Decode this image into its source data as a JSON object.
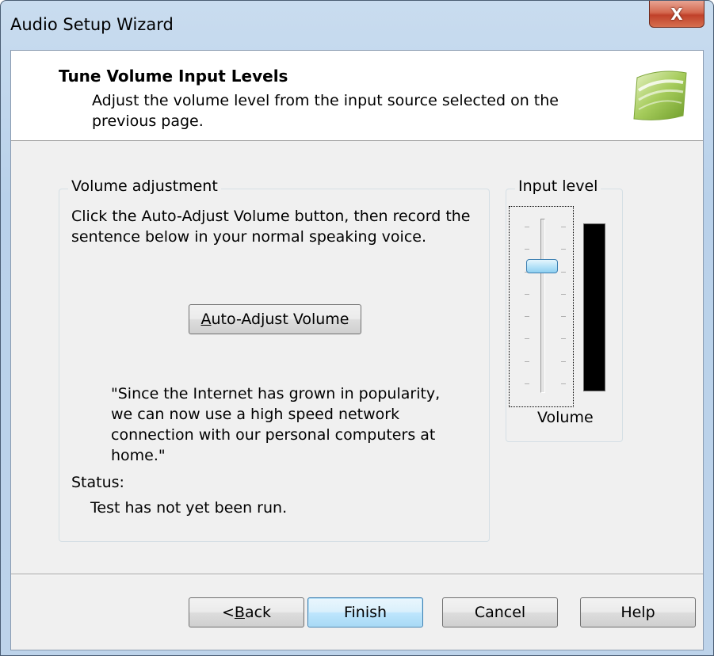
{
  "window": {
    "title": "Audio Setup Wizard",
    "close_glyph": "X"
  },
  "header": {
    "title": "Tune Volume Input Levels",
    "subtitle": "Adjust the volume level from the input source selected on the previous page.",
    "logo_icon": "wizard-logo-icon"
  },
  "volume_group": {
    "label": "Volume adjustment",
    "instructions": "Click the Auto-Adjust Volume button, then record the sentence below in your normal speaking voice.",
    "auto_adjust": {
      "accel": "A",
      "rest": "uto-Adjust Volume"
    },
    "sentence": "\"Since the Internet has grown in popularity, we can now use a high speed network connection with our personal computers at home.\"",
    "status_label": "Status:",
    "status_text": "Test has not yet been run."
  },
  "input_group": {
    "label": "Input level",
    "slider_label": "Volume",
    "slider_level": 0.75,
    "meter_level": 0.0
  },
  "buttons": {
    "back_prefix": "< ",
    "back_accel": "B",
    "back_rest": "ack",
    "finish": "Finish",
    "cancel": "Cancel",
    "help": "Help"
  },
  "colors": {
    "accent": "#3c7fb1",
    "close": "#c0412a",
    "meter_bg": "#000000"
  }
}
